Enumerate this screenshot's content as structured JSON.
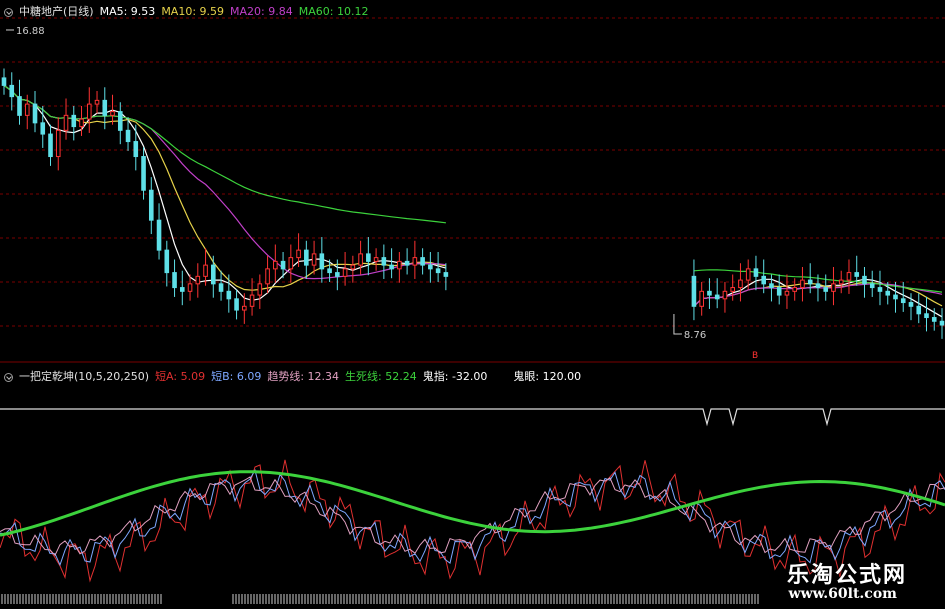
{
  "header_top": {
    "stock": "中糖地产(日线)",
    "items": [
      {
        "label": "MA5: 9.53",
        "color": "#ffffff"
      },
      {
        "label": "MA10: 9.59",
        "color": "#e6d24a"
      },
      {
        "label": "MA20: 9.84",
        "color": "#c040c8"
      },
      {
        "label": "MA60: 10.12",
        "color": "#3cd23c"
      }
    ]
  },
  "price_high_label": "16.88",
  "price_low_label": "8.76",
  "marker_text": "B",
  "header_bottom": {
    "indicator": "一把定乾坤(10,5,20,250)",
    "items": [
      {
        "label": "短A: 5.09",
        "color": "#e03030"
      },
      {
        "label": "短B: 6.09",
        "color": "#7ea8ff"
      },
      {
        "label": "趋势线: 12.34",
        "color": "#e0a0c0"
      },
      {
        "label": "生死线: 52.24",
        "color": "#3cd23c"
      },
      {
        "label": "鬼指: -32.00",
        "color": "#ffffff"
      },
      {
        "label": "鬼眼: 120.00",
        "color": "#ffffff"
      }
    ]
  },
  "watermark": {
    "title": "乐淘公式网",
    "url": "www.60lt.com"
  },
  "colors": {
    "up": "#ff3333",
    "down": "#5fe0e8",
    "grid": "#7a0000",
    "ma5": "#ffffff",
    "ma10": "#e6d24a",
    "ma20": "#c040c8",
    "ma60": "#3cd23c"
  },
  "chart_data": [
    {
      "type": "candlestick",
      "title": "中糖地产(日线)",
      "ylim": [
        8.6,
        17.2
      ],
      "annotations": [
        "16.88",
        "8.76"
      ],
      "series": [
        {
          "name": "MA5",
          "value": 9.53
        },
        {
          "name": "MA10",
          "value": 9.59
        },
        {
          "name": "MA20",
          "value": 9.84
        },
        {
          "name": "MA60",
          "value": 10.12
        }
      ],
      "close": [
        15.4,
        15.1,
        14.6,
        14.9,
        14.4,
        14.1,
        13.5,
        14.2,
        14.6,
        14.3,
        14.5,
        14.9,
        15.0,
        14.6,
        14.7,
        14.2,
        13.9,
        13.5,
        12.6,
        11.8,
        11.0,
        10.4,
        10.0,
        9.9,
        10.1,
        10.3,
        10.6,
        10.1,
        9.9,
        9.7,
        9.4,
        9.5,
        9.8,
        10.1,
        10.5,
        10.7,
        10.5,
        10.8,
        11.0,
        10.6,
        10.9,
        10.5,
        10.4,
        10.3,
        10.5,
        10.6,
        10.9,
        10.7,
        10.8,
        10.6,
        10.5,
        10.7,
        10.6,
        10.8,
        10.6,
        10.5,
        10.4,
        10.3,
        null,
        null,
        null,
        null,
        null,
        null,
        null,
        null,
        null,
        null,
        null,
        null,
        null,
        null,
        null,
        null,
        null,
        null,
        null,
        null,
        null,
        null,
        null,
        null,
        null,
        null,
        null,
        null,
        null,
        null,
        null,
        9.5,
        9.9,
        9.8,
        9.7,
        9.9,
        10.0,
        10.2,
        10.5,
        10.3,
        10.1,
        10.0,
        9.8,
        9.9,
        10.0,
        10.2,
        10.1,
        10.0,
        9.9,
        10.1,
        10.2,
        10.4,
        10.3,
        10.1,
        10.0,
        9.9,
        9.8,
        9.7,
        9.6,
        9.5,
        9.3,
        9.2,
        9.1,
        9.0
      ]
    },
    {
      "type": "line",
      "title": "一把定乾坤(10,5,20,250)",
      "series": [
        {
          "name": "短A",
          "value": 5.09
        },
        {
          "name": "短B",
          "value": 6.09
        },
        {
          "name": "趋势线",
          "value": 12.34
        },
        {
          "name": "生死线",
          "value": 52.24
        },
        {
          "name": "鬼指",
          "value": -32.0
        },
        {
          "name": "鬼眼",
          "value": 120.0
        }
      ]
    }
  ]
}
